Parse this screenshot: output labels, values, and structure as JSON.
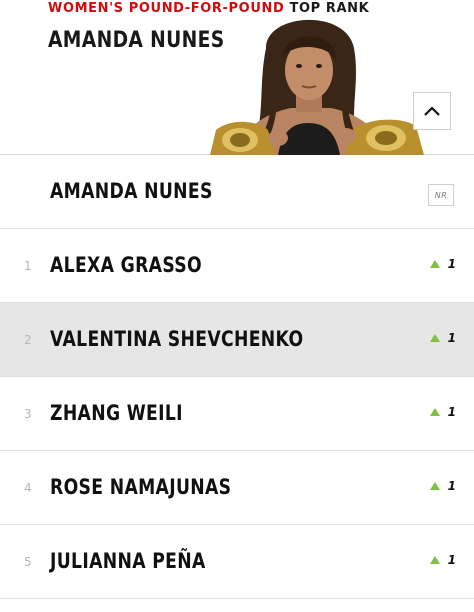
{
  "header": {
    "kicker_red": "WOMEN'S POUND-FOR-POUND",
    "kicker_black": "TOP RANK",
    "champion_name": "AMANDA NUNES",
    "collapse_icon": "chevron-up-icon"
  },
  "champion_row": {
    "name": "AMANDA NUNES",
    "badge": "NR"
  },
  "rankings": [
    {
      "rank": "1",
      "name": "ALEXA GRASSO",
      "movement": "1",
      "direction": "up"
    },
    {
      "rank": "2",
      "name": "VALENTINA SHEVCHENKO",
      "movement": "1",
      "direction": "up"
    },
    {
      "rank": "3",
      "name": "ZHANG WEILI",
      "movement": "1",
      "direction": "up"
    },
    {
      "rank": "4",
      "name": "ROSE NAMAJUNAS",
      "movement": "1",
      "direction": "up"
    },
    {
      "rank": "5",
      "name": "JULIANNA PEÑA",
      "movement": "1",
      "direction": "up"
    }
  ],
  "colors": {
    "accent_red": "#d20a0a",
    "up_arrow_green": "#7cc142",
    "highlight_row": "#e6e6e6"
  }
}
